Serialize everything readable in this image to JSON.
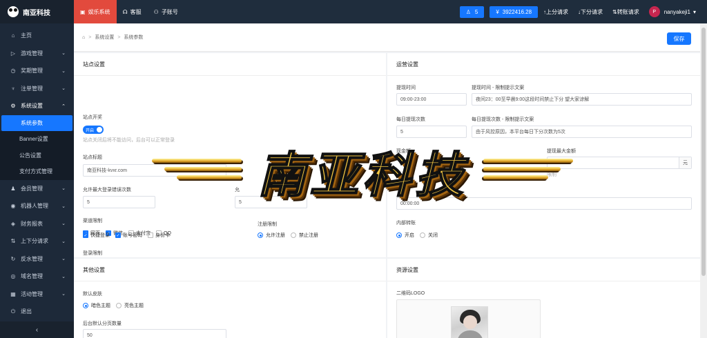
{
  "brand": {
    "name": "南亚科技"
  },
  "sidebar": {
    "items": [
      {
        "label": "主页",
        "icon": "home-icon",
        "glyph": "⌂"
      },
      {
        "label": "游戏管理",
        "icon": "play-icon",
        "glyph": "▷"
      },
      {
        "label": "奖期管理",
        "icon": "clock-icon",
        "glyph": "◷"
      },
      {
        "label": "注单管理",
        "icon": "trophy-icon",
        "glyph": "♆"
      },
      {
        "label": "系统设置",
        "icon": "gear-icon",
        "glyph": "⚙"
      }
    ],
    "sub_items": [
      "系统参数",
      "Banner设置",
      "公告设置",
      "支付方式管理"
    ],
    "items_after": [
      {
        "label": "会员管理",
        "icon": "user-icon",
        "glyph": "♟"
      },
      {
        "label": "机器人管理",
        "icon": "robot-icon",
        "glyph": "◉"
      },
      {
        "label": "财务报表",
        "icon": "report-icon",
        "glyph": "◈"
      },
      {
        "label": "上下分请求",
        "icon": "transfer-icon",
        "glyph": "⇅"
      },
      {
        "label": "反水管理",
        "icon": "rebate-icon",
        "glyph": "↻"
      },
      {
        "label": "域名管理",
        "icon": "globe-icon",
        "glyph": "◎"
      },
      {
        "label": "活动管理",
        "icon": "calendar-icon",
        "glyph": "▦"
      },
      {
        "label": "退出",
        "icon": "logout-icon",
        "glyph": "⏻"
      }
    ]
  },
  "topnav": {
    "items": [
      "娱乐系统",
      "客服",
      "子账号"
    ]
  },
  "topbar": {
    "online_count": "5",
    "balance": "3922416.28",
    "up_request": "上分请求",
    "down_request": "下分请求",
    "transfer_request": "转账请求",
    "username": "nanyakeji1",
    "avatar_letter": "P"
  },
  "breadcrumb": [
    "系统设置",
    "系统参数"
  ],
  "save_label": "保存",
  "site": {
    "title": "站点设置",
    "switch_label": "站点开奖",
    "switch_value": "开启",
    "switch_hint": "站点关闭后将不能访问，后台可以正常登录",
    "site_title_label": "站点标题",
    "site_title_value": "南亚科技-kvxr.com",
    "max_login_label": "允许最大登录错误次数",
    "max_login_value": "5",
    "sidebar_cut_label": "允",
    "sidebar_cut_value": "5",
    "channel_label": "渠道限制",
    "channel_options": [
      {
        "label": "网页",
        "checked": true
      },
      {
        "label": "微信",
        "checked": true
      },
      {
        "label": "支付宝",
        "checked": false
      },
      {
        "label": "QQ",
        "checked": false
      }
    ],
    "login_label": "登录限制",
    "login_options": [
      {
        "label": "快捷登录",
        "checked": true
      },
      {
        "label": "账号密码",
        "checked": true
      },
      {
        "label": "身份卡",
        "checked": false
      }
    ],
    "register_label": "注册限制",
    "register_options": [
      {
        "label": "允许注册",
        "checked": true
      },
      {
        "label": "禁止注册",
        "checked": false
      }
    ]
  },
  "ops": {
    "title": "运营设置",
    "withdraw_time_label": "提现时间",
    "withdraw_time_value": "09:00-23:00",
    "withdraw_time_msg_label": "提现时间 - 限制提示文案",
    "withdraw_time_msg_value": "夜间23：00至早晨9:00这段时间禁止下分 望大家谅解",
    "daily_times_label": "每日提现次数",
    "daily_times_value": "5",
    "daily_times_msg_label": "每日提现次数 - 限制提示文案",
    "daily_times_msg_value": "由于风控原因，本平台每日下分次数为5次",
    "min_amount_label_fragment": "现",
    "min_amount_label_fragment2": "金额",
    "max_amount_label": "提现最大金额",
    "amount_suffix": "元",
    "max_amount_hint": "限制",
    "time_value": "00:00:00",
    "internal_label": "内部转账",
    "internal_options": [
      {
        "label": "开启",
        "checked": true
      },
      {
        "label": "关闭",
        "checked": false
      }
    ]
  },
  "other": {
    "title": "其他设置",
    "skin_label": "默认皮肤",
    "skin_options": [
      {
        "label": "暗色主题",
        "checked": true
      },
      {
        "label": "亮色主题",
        "checked": false
      }
    ],
    "page_size_label": "后台默认分页数量",
    "page_size_value": "50"
  },
  "resources": {
    "title": "资源设置",
    "qr_label": "二维码LOGO"
  },
  "watermark": {
    "text": "南亚科技"
  }
}
